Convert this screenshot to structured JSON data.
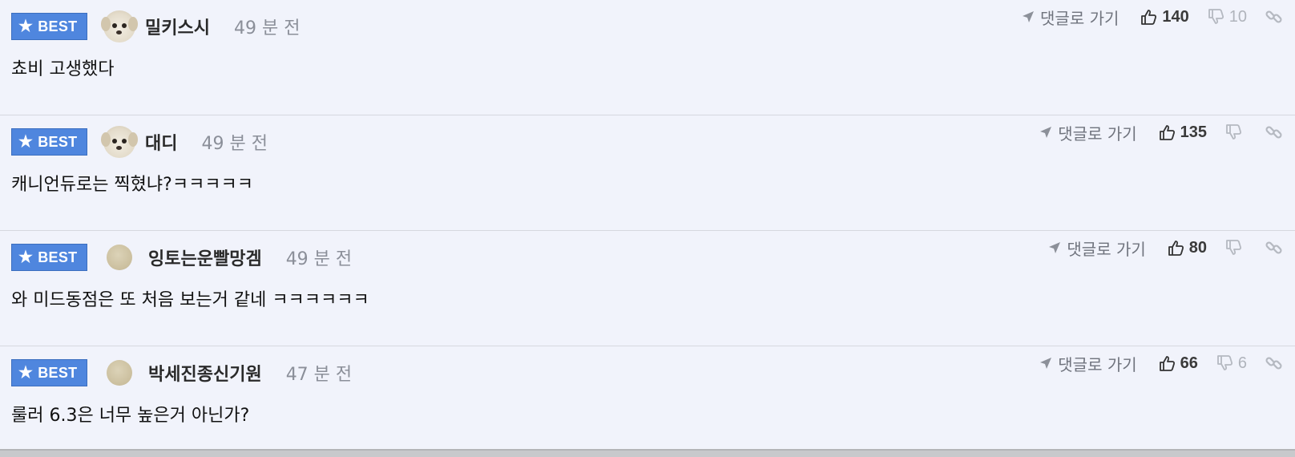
{
  "badge_label": "BEST",
  "reply_label": "댓글로 가기",
  "colors": {
    "badge_bg": "#4f86de",
    "background": "#f1f3fb",
    "time": "#8b8f99"
  },
  "comments": [
    {
      "nickname": "밀키스시",
      "avatar": "dog",
      "time": "49 분 전",
      "text": "쵸비 고생했다",
      "upvotes": "140",
      "downvotes": "10"
    },
    {
      "nickname": "대디",
      "avatar": "dog",
      "time": "49 분 전",
      "text": "캐니언듀로는 찍혔냐?ㅋㅋㅋㅋㅋ",
      "upvotes": "135",
      "downvotes": ""
    },
    {
      "nickname": "잉토는운빨망겜",
      "avatar": "plain",
      "time": "49 분 전",
      "text": "와 미드동점은 또 처음 보는거 같네 ㅋㅋㅋㅋㅋㅋ",
      "upvotes": "80",
      "downvotes": ""
    },
    {
      "nickname": "박세진종신기원",
      "avatar": "plain",
      "time": "47 분 전",
      "text": "룰러 6.3은 너무 높은거 아닌가?",
      "upvotes": "66",
      "downvotes": "6"
    }
  ]
}
